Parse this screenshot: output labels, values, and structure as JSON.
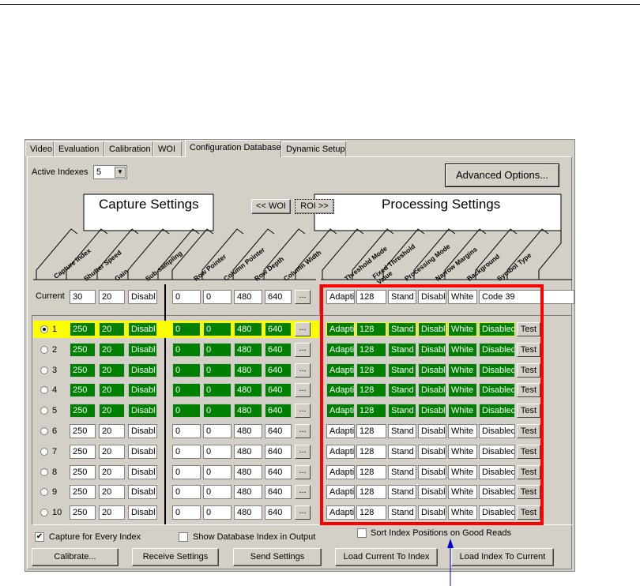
{
  "tabs": [
    "Video",
    "Evaluation",
    "Calibration",
    "WOI",
    "Configuration Database",
    "Dynamic Setup"
  ],
  "active_tab": "Configuration Database",
  "active_indexes": {
    "label": "Active Indexes",
    "value": "5"
  },
  "advanced_options_label": "Advanced Options...",
  "capture_settings_title": "Capture Settings",
  "processing_settings_title": "Processing Settings",
  "woi_button": "<< WOI",
  "roi_button": "ROI >>",
  "capture_headers": [
    "Capture Index",
    "Shutter Speed",
    "Gain",
    "Sub-sampling"
  ],
  "roi_headers": [
    "Row Pointer",
    "Column Pointer",
    "Row Depth",
    "Column Width"
  ],
  "processing_headers": [
    "Threshold Mode",
    "Fixed Threshold Value",
    "Processing Mode",
    "Narrow Margins",
    "Background",
    "Symbol Type"
  ],
  "current": {
    "label": "Current",
    "shutter": "30",
    "gain": "20",
    "subsampling": "Disabl",
    "row_pointer": "0",
    "col_pointer": "0",
    "row_depth": "480",
    "col_width": "640",
    "threshold_mode": "Adapti",
    "fixed_threshold": "128",
    "processing_mode": "Stand",
    "narrow_margins": "Disabl",
    "background": "White",
    "symbol_type": "Code 39"
  },
  "ellipsis": "...",
  "test_label": "Test",
  "rows": [
    {
      "index": "1",
      "shutter": "250",
      "gain": "20",
      "sub": "Disabl",
      "rp": "0",
      "cp": "0",
      "rd": "480",
      "cw": "640",
      "tm": "Adapti",
      "ft": "128",
      "pm": "Stand",
      "nm": "Disabl",
      "bg": "White",
      "st": "Disabled"
    },
    {
      "index": "2",
      "shutter": "250",
      "gain": "20",
      "sub": "Disabl",
      "rp": "0",
      "cp": "0",
      "rd": "480",
      "cw": "640",
      "tm": "Adapti",
      "ft": "128",
      "pm": "Stand",
      "nm": "Disabl",
      "bg": "White",
      "st": "Disabled"
    },
    {
      "index": "3",
      "shutter": "250",
      "gain": "20",
      "sub": "Disabl",
      "rp": "0",
      "cp": "0",
      "rd": "480",
      "cw": "640",
      "tm": "Adapti",
      "ft": "128",
      "pm": "Stand",
      "nm": "Disabl",
      "bg": "White",
      "st": "Disabled"
    },
    {
      "index": "4",
      "shutter": "250",
      "gain": "20",
      "sub": "Disabl",
      "rp": "0",
      "cp": "0",
      "rd": "480",
      "cw": "640",
      "tm": "Adapti",
      "ft": "128",
      "pm": "Stand",
      "nm": "Disabl",
      "bg": "White",
      "st": "Disabled"
    },
    {
      "index": "5",
      "shutter": "250",
      "gain": "20",
      "sub": "Disabl",
      "rp": "0",
      "cp": "0",
      "rd": "480",
      "cw": "640",
      "tm": "Adapti",
      "ft": "128",
      "pm": "Stand",
      "nm": "Disabl",
      "bg": "White",
      "st": "Disabled"
    },
    {
      "index": "6",
      "shutter": "250",
      "gain": "20",
      "sub": "Disabl",
      "rp": "0",
      "cp": "0",
      "rd": "480",
      "cw": "640",
      "tm": "Adapti",
      "ft": "128",
      "pm": "Stand",
      "nm": "Disabl",
      "bg": "White",
      "st": "Disabled"
    },
    {
      "index": "7",
      "shutter": "250",
      "gain": "20",
      "sub": "Disabl",
      "rp": "0",
      "cp": "0",
      "rd": "480",
      "cw": "640",
      "tm": "Adapti",
      "ft": "128",
      "pm": "Stand",
      "nm": "Disabl",
      "bg": "White",
      "st": "Disabled"
    },
    {
      "index": "8",
      "shutter": "250",
      "gain": "20",
      "sub": "Disabl",
      "rp": "0",
      "cp": "0",
      "rd": "480",
      "cw": "640",
      "tm": "Adapti",
      "ft": "128",
      "pm": "Stand",
      "nm": "Disabl",
      "bg": "White",
      "st": "Disabled"
    },
    {
      "index": "9",
      "shutter": "250",
      "gain": "20",
      "sub": "Disabl",
      "rp": "0",
      "cp": "0",
      "rd": "480",
      "cw": "640",
      "tm": "Adapti",
      "ft": "128",
      "pm": "Stand",
      "nm": "Disabl",
      "bg": "White",
      "st": "Disabled"
    },
    {
      "index": "10",
      "shutter": "250",
      "gain": "20",
      "sub": "Disabl",
      "rp": "0",
      "cp": "0",
      "rd": "480",
      "cw": "640",
      "tm": "Adapti",
      "ft": "128",
      "pm": "Stand",
      "nm": "Disabl",
      "bg": "White",
      "st": "Disabled"
    }
  ],
  "active_count": 5,
  "selected_index": 1,
  "checkboxes": {
    "capture_every_index": {
      "label": "Capture for Every Index",
      "checked": true
    },
    "show_db_index": {
      "label": "Show Database Index in Output",
      "checked": false
    },
    "sort_index": {
      "label": "Sort Index Positions on Good Reads",
      "checked": false
    }
  },
  "buttons": {
    "calibrate": "Calibrate...",
    "receive": "Receive Settings",
    "send": "Send Settings",
    "load_current_to_index": "Load Current To Index",
    "load_index_to_current": "Load Index To Current"
  },
  "colors": {
    "active_row_fill": "#008000",
    "selected_row_highlight": "#ffff00",
    "callout_red": "#ff0000",
    "callout_arrow": "#0000cc"
  }
}
